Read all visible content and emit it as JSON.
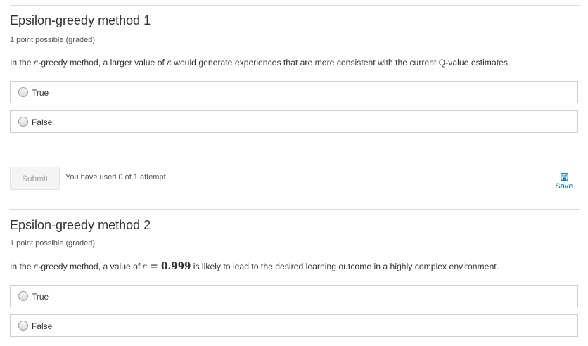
{
  "problems": [
    {
      "title": "Epsilon-greedy method 1",
      "points": "1 point possible (graded)",
      "question": {
        "before": "In the ",
        "symbol": "ε",
        "middle": "-greedy method, a larger value of ",
        "symbol2": "ε",
        "after": " would generate experiences that are more consistent with the current Q-value estimates."
      },
      "choices": [
        {
          "label": "True"
        },
        {
          "label": "False"
        }
      ],
      "submit_label": "Submit",
      "attempts_text": "You have used 0 of 1 attempt",
      "save_label": "Save"
    },
    {
      "title": "Epsilon-greedy method 2",
      "points": "1 point possible (graded)",
      "question": {
        "before": "In the ",
        "symbol": "ε",
        "middle": "-greedy method, a value of ",
        "math_symbol": "ε",
        "math_eq": " = ",
        "math_value": "0.999",
        "after": " is likely to lead to the desired learning outcome in a highly complex environment."
      },
      "choices": [
        {
          "label": "True"
        },
        {
          "label": "False"
        }
      ]
    }
  ],
  "colors": {
    "link": "#0075b4",
    "border": "#cfcfcf",
    "divider": "#dddddd"
  }
}
